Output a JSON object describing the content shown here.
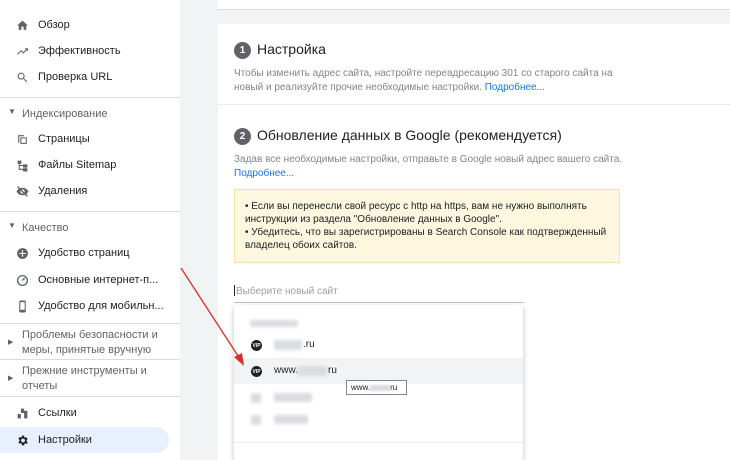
{
  "sidebar": {
    "top_items": [
      {
        "label": "Обзор",
        "icon": "home-icon"
      },
      {
        "label": "Эффективность",
        "icon": "trending-icon"
      },
      {
        "label": "Проверка URL",
        "icon": "search-icon"
      }
    ],
    "indexing": {
      "title": "Индексирование",
      "items": [
        {
          "label": "Страницы",
          "icon": "pages-icon"
        },
        {
          "label": "Файлы Sitemap",
          "icon": "sitemap-icon"
        },
        {
          "label": "Удаления",
          "icon": "removals-icon"
        }
      ]
    },
    "quality": {
      "title": "Качество",
      "items": [
        {
          "label": "Удобство страниц",
          "icon": "page-experience-icon"
        },
        {
          "label": "Основные интернет-п...",
          "icon": "vitals-icon"
        },
        {
          "label": "Удобство для мобильн...",
          "icon": "mobile-icon"
        }
      ]
    },
    "security": {
      "title_line1": "Проблемы безопасности и",
      "title_line2": "меры, принятые вручную"
    },
    "legacy": {
      "title_line1": "Прежние инструменты и",
      "title_line2": "отчеты"
    },
    "bottom_items": [
      {
        "label": "Ссылки",
        "icon": "links-icon"
      },
      {
        "label": "Настройки",
        "icon": "settings-icon"
      }
    ]
  },
  "main": {
    "step1": {
      "number": "1",
      "title": "Настройка",
      "desc_line1": "Чтобы изменить адрес сайта, настройте переадресацию 301 со старого сайта на",
      "desc_line2": "новый и реализуйте прочие необходимые настройки.",
      "link": "Подробнее..."
    },
    "step2": {
      "number": "2",
      "title": "Обновление данных в Google (рекомендуется)",
      "desc_line1": "Задав все необходимые настройки, отправьте в Google новый адрес вашего сайта.",
      "link": "Подробнее..."
    },
    "warning": {
      "line1": "• Если вы перенесли свой ресурс с http на https, вам не нужно выполнять",
      "line2": "инструкции из раздела \"Обновление данных в Google\".",
      "line3": "• Убедитесь, что вы зарегистрированы в Search Console как подтвержденный",
      "line4": "владелец обоих сайтов."
    },
    "site_select": {
      "placeholder": "Выберите новый сайт"
    },
    "dropdown": {
      "item1": {
        "badge": "VIP",
        "suffix": ".ru"
      },
      "item2": {
        "badge": "VIP",
        "prefix": "www.",
        "suffix": "ru"
      }
    },
    "tooltip": {
      "prefix": "www.",
      "suffix": "ru"
    }
  },
  "colors": {
    "accent": "#1a73e8",
    "active_bg": "#e8f0fe",
    "warning_bg": "#fef7e0",
    "arrow": "#d93025"
  }
}
